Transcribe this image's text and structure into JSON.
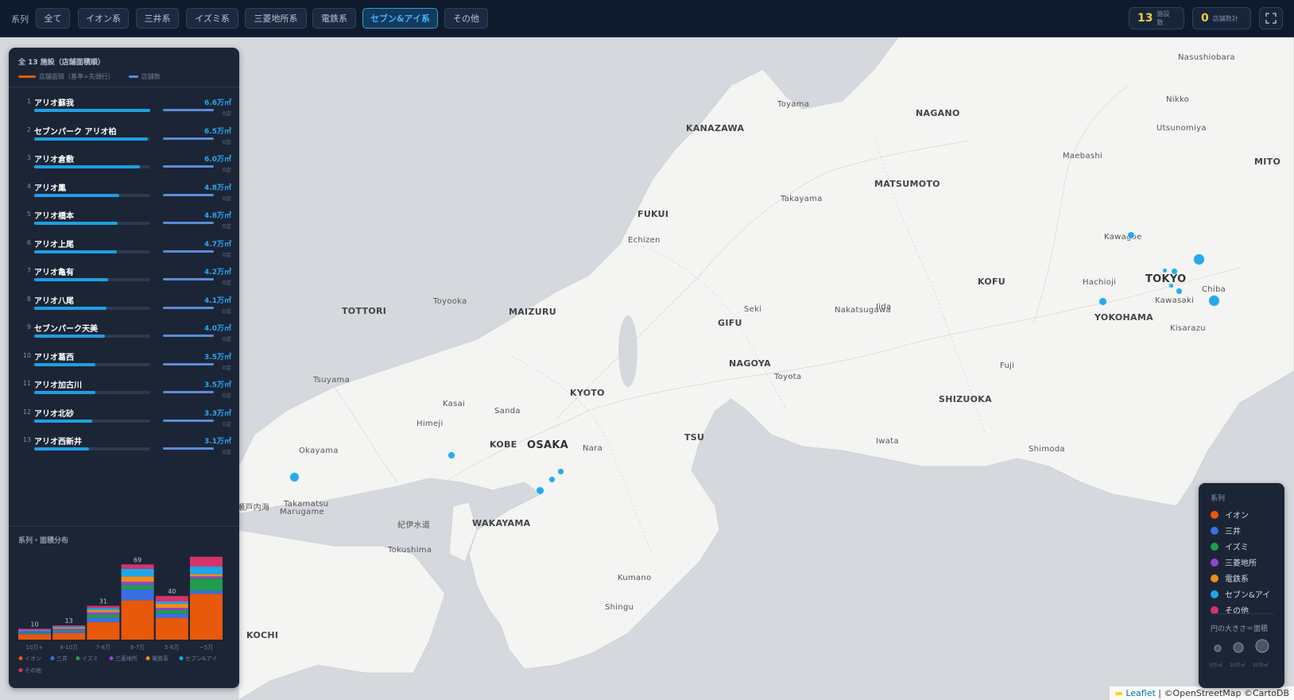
{
  "topbar": {
    "label": "系列",
    "tabs": [
      {
        "label": "全て"
      },
      {
        "label": "イオン系"
      },
      {
        "label": "三井系"
      },
      {
        "label": "イズミ系"
      },
      {
        "label": "三菱地所系"
      },
      {
        "label": "電鉄系"
      },
      {
        "label": "セブン&アイ系",
        "active": true
      },
      {
        "label": "その他"
      }
    ],
    "stats": [
      {
        "num": "13",
        "label": "施設数"
      },
      {
        "num": "0",
        "label": "店舗数計"
      }
    ]
  },
  "panel": {
    "title": "全 13 施設（店舗面積順）",
    "legend_area": "店舗面積（基準=先頭行）",
    "legend_count": "店舗数",
    "rows": [
      {
        "rank": "1",
        "name": "アリオ蘇我",
        "value": "6.6万㎡",
        "count": "0店",
        "share": 1.0
      },
      {
        "rank": "2",
        "name": "セブンパーク アリオ柏",
        "value": "6.5万㎡",
        "count": "0店",
        "share": 0.98
      },
      {
        "rank": "3",
        "name": "アリオ倉敷",
        "value": "6.0万㎡",
        "count": "0店",
        "share": 0.91
      },
      {
        "rank": "4",
        "name": "アリオ鳳",
        "value": "4.8万㎡",
        "count": "0店",
        "share": 0.73
      },
      {
        "rank": "5",
        "name": "アリオ橋本",
        "value": "4.8万㎡",
        "count": "0店",
        "share": 0.72
      },
      {
        "rank": "6",
        "name": "アリオ上尾",
        "value": "4.7万㎡",
        "count": "0店",
        "share": 0.71
      },
      {
        "rank": "7",
        "name": "アリオ亀有",
        "value": "4.2万㎡",
        "count": "0店",
        "share": 0.64
      },
      {
        "rank": "8",
        "name": "アリオ八尾",
        "value": "4.1万㎡",
        "count": "0店",
        "share": 0.62
      },
      {
        "rank": "9",
        "name": "セブンパーク天美",
        "value": "4.0万㎡",
        "count": "0店",
        "share": 0.61
      },
      {
        "rank": "10",
        "name": "アリオ葛西",
        "value": "3.5万㎡",
        "count": "0店",
        "share": 0.53
      },
      {
        "rank": "11",
        "name": "アリオ加古川",
        "value": "3.5万㎡",
        "count": "0店",
        "share": 0.53
      },
      {
        "rank": "12",
        "name": "アリオ北砂",
        "value": "3.3万㎡",
        "count": "0店",
        "share": 0.5
      },
      {
        "rank": "13",
        "name": "アリオ西新井",
        "value": "3.1万㎡",
        "count": "0店",
        "share": 0.47
      }
    ]
  },
  "chart_data": {
    "type": "bar",
    "title": "系列・面積分布",
    "categories": [
      "10万+",
      "8-10万",
      "7-8万",
      "6-7万",
      "5-6万",
      "~5万"
    ],
    "totals": [
      10,
      13,
      31,
      69,
      40,
      null
    ],
    "colors": {
      "イオン": "#e8590c",
      "三井": "#3b6fe0",
      "イズミ": "#1f9d4c",
      "三菱地所": "#8e44d6",
      "電鉄系": "#f08c1a",
      "セブン&アイ": "#1ea7e8",
      "その他": "#d6336c"
    },
    "series": [
      {
        "name": "イオン",
        "values": [
          5,
          6,
          16,
          36,
          20,
          42
        ]
      },
      {
        "name": "三井",
        "values": [
          1,
          2,
          4,
          10,
          4,
          3
        ]
      },
      {
        "name": "イズミ",
        "values": [
          1,
          1,
          3,
          4,
          3,
          11
        ]
      },
      {
        "name": "三菱地所",
        "values": [
          1,
          1,
          2,
          3,
          2,
          2
        ]
      },
      {
        "name": "電鉄系",
        "values": [
          0,
          1,
          2,
          5,
          4,
          2
        ]
      },
      {
        "name": "セブン&アイ",
        "values": [
          1,
          1,
          2,
          7,
          2,
          7
        ]
      },
      {
        "name": "その他",
        "values": [
          1,
          1,
          2,
          4,
          5,
          9
        ]
      }
    ],
    "ylim": [
      0,
      86
    ],
    "legend": [
      "イオン",
      "三井",
      "イズミ",
      "三菱地所",
      "電鉄系",
      "セブン&アイ",
      "その他"
    ]
  },
  "legend_box": {
    "title": "系列",
    "items": [
      {
        "label": "イオン",
        "color": "#e8590c"
      },
      {
        "label": "三井",
        "color": "#3b6fe0"
      },
      {
        "label": "イズミ",
        "color": "#1f9d4c"
      },
      {
        "label": "三菱地所",
        "color": "#8e44d6"
      },
      {
        "label": "電鉄系",
        "color": "#f08c1a"
      },
      {
        "label": "セブン&アイ",
        "color": "#1ea7e8"
      },
      {
        "label": "その他",
        "color": "#d6336c"
      }
    ],
    "size_title": "円の大きさ＝面積",
    "sizes": [
      "0万㎡",
      "10万㎡",
      "20万㎡"
    ]
  },
  "map": {
    "places": [
      {
        "t": "Toyama",
        "c": "place"
      },
      {
        "t": "KANAZAWA",
        "c": "major"
      },
      {
        "t": "NAGANO",
        "c": "major"
      },
      {
        "t": "Nasushiobara",
        "c": "place"
      },
      {
        "t": "Nikko",
        "c": "place"
      },
      {
        "t": "Utsunomiya",
        "c": "place"
      },
      {
        "t": "Maebashi",
        "c": "place"
      },
      {
        "t": "MITO",
        "c": "major"
      },
      {
        "t": "MATSUMOTO",
        "c": "major"
      },
      {
        "t": "FUKUI",
        "c": "major"
      },
      {
        "t": "Takayama",
        "c": "place"
      },
      {
        "t": "Echizen",
        "c": "place"
      },
      {
        "t": "Kawagoe",
        "c": "place"
      },
      {
        "t": "KOFU",
        "c": "major"
      },
      {
        "t": "Hachioji",
        "c": "place"
      },
      {
        "t": "TOKYO",
        "c": "big"
      },
      {
        "t": "Kawasaki",
        "c": "place"
      },
      {
        "t": "YOKOHAMA",
        "c": "major"
      },
      {
        "t": "Kisarazu",
        "c": "place"
      },
      {
        "t": "Chiba",
        "c": "place"
      },
      {
        "t": "TOTTORI",
        "c": "major"
      },
      {
        "t": "Toyooka",
        "c": "place"
      },
      {
        "t": "MAIZURU",
        "c": "major"
      },
      {
        "t": "Seki",
        "c": "place"
      },
      {
        "t": "Nakatsugawa",
        "c": "place"
      },
      {
        "t": "Iida",
        "c": "place"
      },
      {
        "t": "GIFU",
        "c": "major"
      },
      {
        "t": "NAGOYA",
        "c": "major"
      },
      {
        "t": "Toyota",
        "c": "place"
      },
      {
        "t": "KYOTO",
        "c": "major"
      },
      {
        "t": "Fuji",
        "c": "place"
      },
      {
        "t": "SHIZUOKA",
        "c": "major"
      },
      {
        "t": "Tsuyama",
        "c": "place"
      },
      {
        "t": "Kasai",
        "c": "place"
      },
      {
        "t": "Sanda",
        "c": "place"
      },
      {
        "t": "Himeji",
        "c": "place"
      },
      {
        "t": "KOBE",
        "c": "major"
      },
      {
        "t": "OSAKA",
        "c": "big"
      },
      {
        "t": "Nara",
        "c": "place"
      },
      {
        "t": "TSU",
        "c": "major"
      },
      {
        "t": "Iwata",
        "c": "place"
      },
      {
        "t": "Shimoda",
        "c": "place"
      },
      {
        "t": "Okayama",
        "c": "place"
      },
      {
        "t": "Takamatsu",
        "c": "place"
      },
      {
        "t": "Marugame",
        "c": "place"
      },
      {
        "t": "WAKAYAMA",
        "c": "major"
      },
      {
        "t": "Tokushima",
        "c": "place"
      },
      {
        "t": "Kumano",
        "c": "place"
      },
      {
        "t": "Shingu",
        "c": "place"
      },
      {
        "t": "KOCHI",
        "c": "major"
      },
      {
        "t": "瀬戸内海",
        "c": "place"
      },
      {
        "t": "紀伊水道",
        "c": "place"
      }
    ]
  },
  "attribution": {
    "leaflet": "Leaflet",
    "rest": " | ©OpenStreetMap ©CartoDB"
  }
}
